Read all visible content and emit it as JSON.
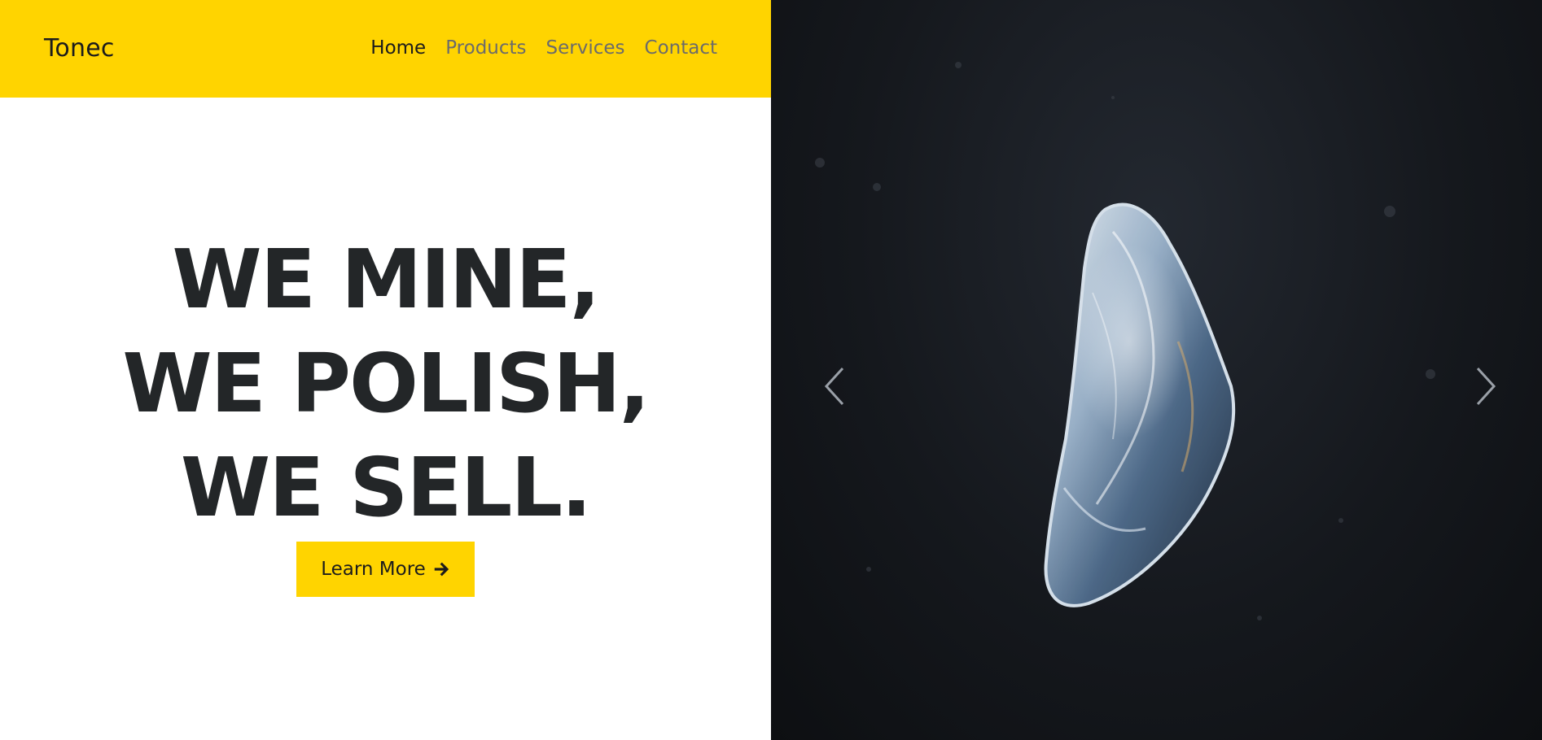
{
  "brand": "Tonec",
  "nav": {
    "items": [
      {
        "label": "Home",
        "active": true
      },
      {
        "label": "Products",
        "active": false
      },
      {
        "label": "Services",
        "active": false
      },
      {
        "label": "Contact",
        "active": false
      }
    ]
  },
  "hero": {
    "lines": [
      "WE MINE,",
      "WE POLISH,",
      "WE SELL."
    ],
    "cta_label": "Learn More",
    "cta_icon": "arrow-right-icon"
  },
  "carousel": {
    "prev_icon": "chevron-left-icon",
    "next_icon": "chevron-right-icon"
  },
  "colors": {
    "accent": "#ffd400",
    "text_dark": "#232628",
    "nav_inactive": "#6b6b6b",
    "image_background": "#15181d"
  }
}
